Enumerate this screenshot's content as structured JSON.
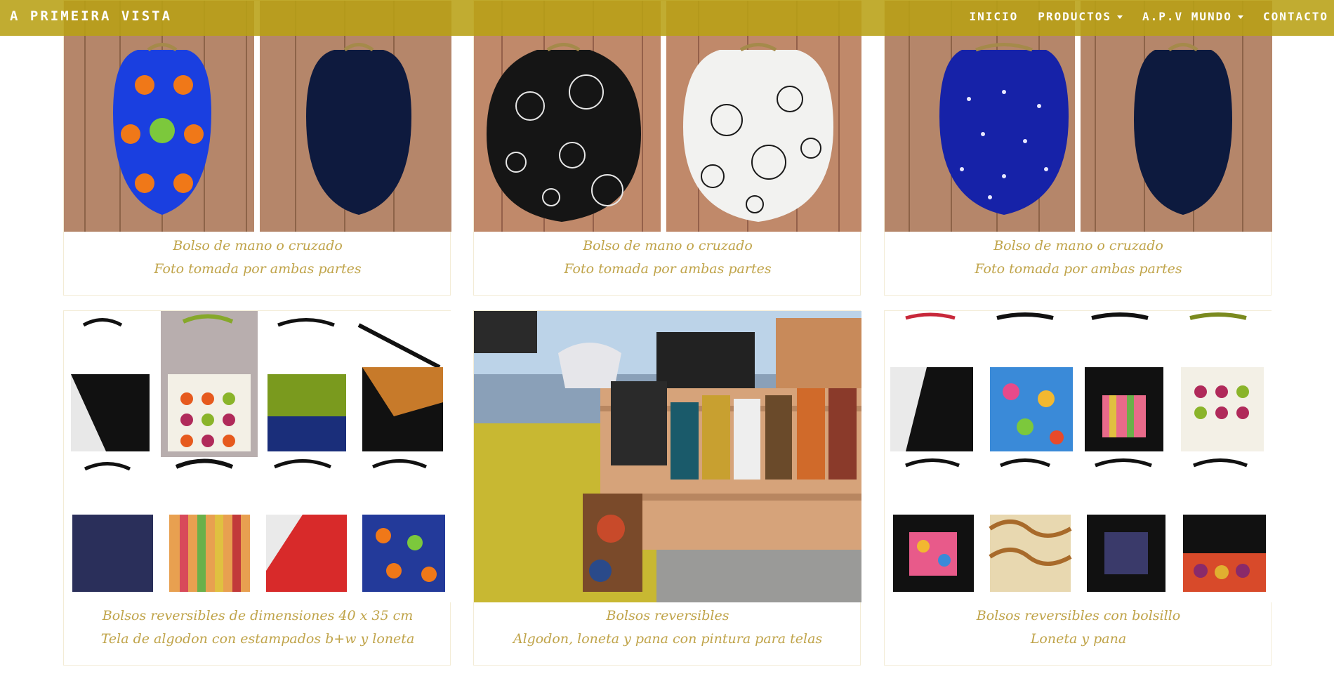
{
  "nav": {
    "brand": "A PRIMEIRA VISTA",
    "items": [
      {
        "label": "INICIO",
        "dropdown": false
      },
      {
        "label": "PRODUCTOS",
        "dropdown": true
      },
      {
        "label": "A.P.V MUNDO",
        "dropdown": true
      },
      {
        "label": "CONTACTO",
        "dropdown": false
      }
    ]
  },
  "cards": [
    {
      "line1": "Bolso de mano o cruzado",
      "line2": "Foto tomada por ambas partes"
    },
    {
      "line1": "Bolso de mano o cruzado",
      "line2": "Foto tomada por ambas partes"
    },
    {
      "line1": "Bolso de mano o cruzado",
      "line2": "Foto tomada por ambas partes"
    },
    {
      "line1": "Bolsos reversibles de dimensiones 40 x 35 cm",
      "line2": "Tela de algodon con estampados b+w y loneta"
    },
    {
      "line1": "Bolsos reversibles",
      "line2": "Algodon, loneta y pana con pintura para telas"
    },
    {
      "line1": "Bolsos reversibles con bolsillo",
      "line2": "Loneta y pana"
    }
  ],
  "colors": {
    "navbar": "#b8a014",
    "caption": "#c0a44a",
    "wood": "#b5866a"
  }
}
